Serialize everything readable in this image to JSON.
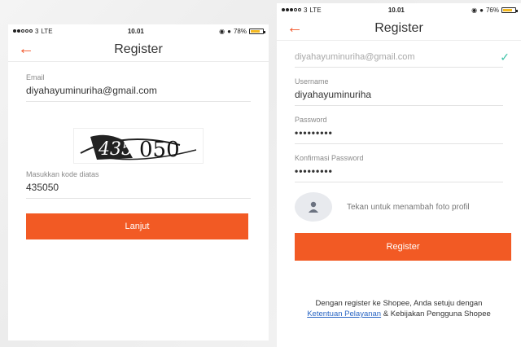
{
  "left_screen": {
    "status": {
      "carrier": "3",
      "network": "LTE",
      "time": "10.01",
      "battery": "78%"
    },
    "nav": {
      "title": "Register"
    },
    "email": {
      "label": "Email",
      "value": "diyahayuminuriha@gmail.com"
    },
    "captcha": {
      "image_text": "435050"
    },
    "code": {
      "label": "Masukkan kode diatas",
      "value": "435050"
    },
    "continue_label": "Lanjut"
  },
  "right_screen": {
    "status": {
      "carrier": "3",
      "network": "LTE",
      "time": "10.01",
      "battery": "76%"
    },
    "nav": {
      "title": "Register"
    },
    "email": {
      "value": "diyahayuminuriha@gmail.com"
    },
    "username": {
      "label": "Username",
      "value": "diyahayuminuriha"
    },
    "password": {
      "label": "Password",
      "value": "•••••••••"
    },
    "confirm_password": {
      "label": "Konfirmasi Password",
      "value": "•••••••••"
    },
    "avatar_hint": "Tekan untuk menambah foto profil",
    "register_label": "Register",
    "terms": {
      "line1": "Dengan register ke Shopee, Anda setuju dengan",
      "link": "Ketentuan Pelayanan",
      "line2_rest": "& Kebijakan Pengguna Shopee"
    }
  },
  "colors": {
    "accent": "#f25a24",
    "link": "#2a66c4",
    "check": "#3cc2a6"
  }
}
